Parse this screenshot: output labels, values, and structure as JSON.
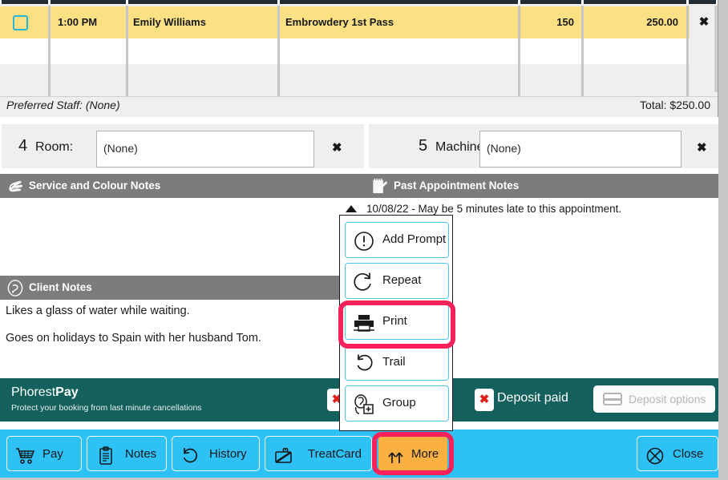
{
  "appointment_table": {
    "columns": [
      "select",
      "time",
      "client",
      "service",
      "duration",
      "price",
      "remove"
    ],
    "rows": [
      {
        "time": "1:00 PM",
        "client": "Emily Williams",
        "service": "Embrowdery 1st Pass",
        "duration": "150",
        "price": "250.00",
        "remove_label": "✖",
        "selected": true
      }
    ],
    "preferred_staff_label": "Preferred Staff:",
    "preferred_staff_value": "(None)",
    "total_label": "Total: $250.00",
    "row_highlight_color": "#fbe183",
    "checkbox_color": "#29b6d8"
  },
  "room_machine": {
    "room": {
      "number": "4",
      "label": "Room:",
      "value": "(None)",
      "clear_label": "✖"
    },
    "machine": {
      "number": "5",
      "label": "Machine:",
      "value": "(None)",
      "clear_label": "✖"
    }
  },
  "notes_panels": {
    "service_colour": {
      "title": "Service and Colour Notes",
      "icon": "hand-scissors-icon",
      "body": ""
    },
    "past_appointment": {
      "title": "Past Appointment Notes",
      "icon": "notepad-pencil-icon",
      "entry": "10/08/22 - May be 5 minutes late to this appointment.",
      "caret": "collapse-caret-up-icon"
    },
    "client_notes": {
      "title": "Client Notes",
      "icon": "client-head-icon",
      "lines": [
        "Likes a glass of water while waiting.",
        "Goes on holidays to Spain with her husband Tom."
      ]
    },
    "header_bg": "#7c7c7c"
  },
  "phorest_pay": {
    "brand_prefix": "Phorest",
    "brand_suffix": "Pay",
    "tagline": "Protect your booking from last minute cancellations",
    "protect_clear_label": "✖",
    "deposit_paid_label": "Deposit paid",
    "deposit_paid_clear_label": "✖",
    "deposit_options_label": "Deposit options",
    "deposit_options_disabled": true,
    "bar_color": "#14605c"
  },
  "toolbar": {
    "bg_color": "#2ec1f5",
    "buttons": [
      {
        "label": "Pay",
        "icon": "shopping-cart-icon"
      },
      {
        "label": "Notes",
        "icon": "clipboard-icon"
      },
      {
        "label": "History",
        "icon": "undo-circle-icon"
      },
      {
        "label": "TreatCard",
        "icon": "gift-card-icon"
      },
      {
        "label": "More",
        "icon": "double-up-arrow-icon",
        "active": true,
        "color": "#fbb042"
      }
    ],
    "close_button": {
      "label": "Close",
      "icon": "close-circle-x-icon"
    }
  },
  "popup_menu": {
    "items": [
      {
        "label": "Add Prompt",
        "icon": "exclamation-circle-icon"
      },
      {
        "label": "Repeat",
        "icon": "repeat-arrow-icon"
      },
      {
        "label": "Print",
        "icon": "printer-icon",
        "highlighted": true
      },
      {
        "label": "Trail",
        "icon": "undo-arrow-icon"
      },
      {
        "label": "Group",
        "icon": "group-add-icon"
      }
    ],
    "border_color": "#4fc5e8"
  },
  "highlights": {
    "ring_color": "#f72259",
    "targets": [
      "Print",
      "More"
    ]
  }
}
